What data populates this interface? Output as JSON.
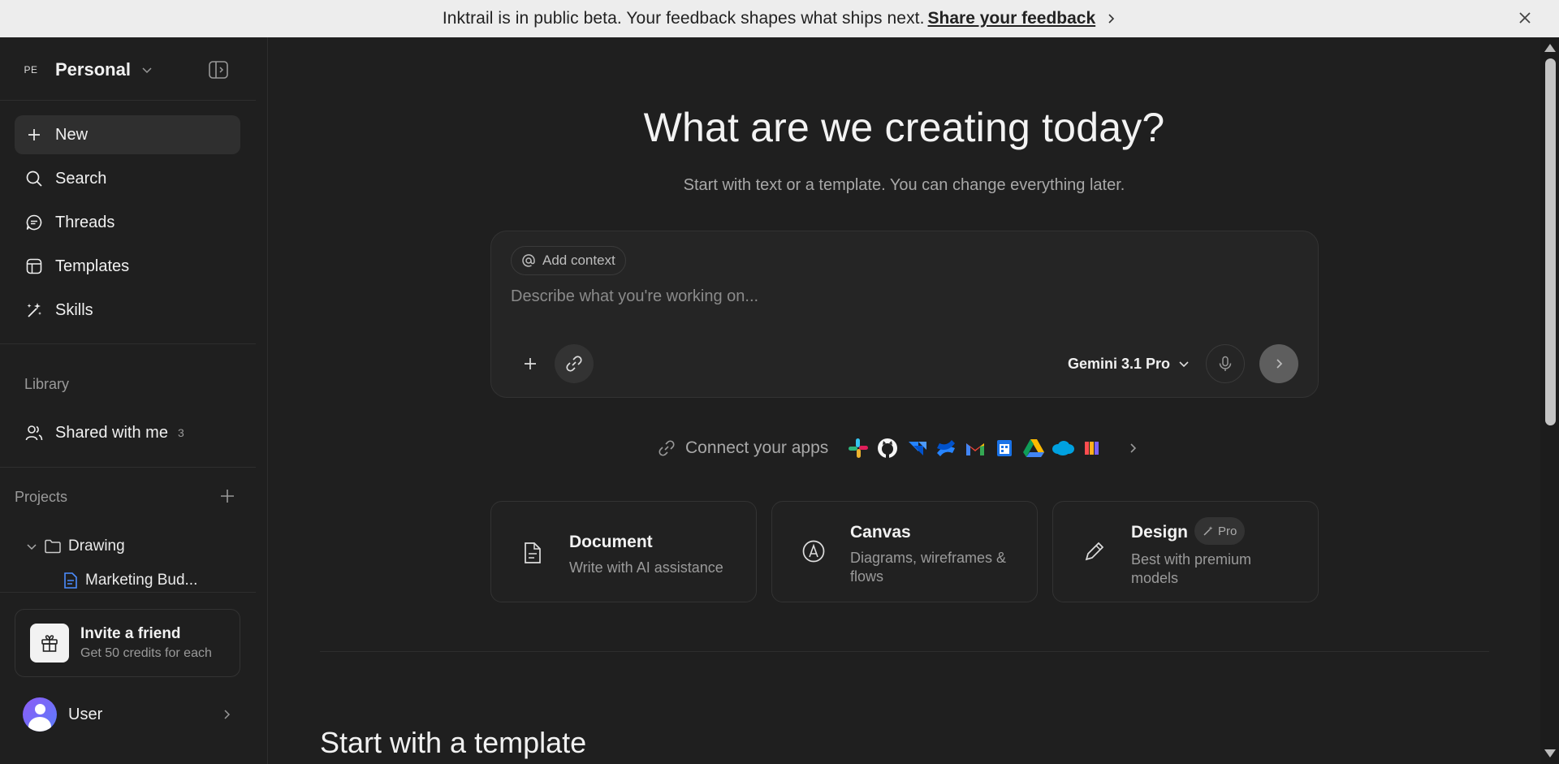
{
  "banner": {
    "message": "Inktrail is in public beta. Your feedback shapes what ships next.",
    "link_label": "Share your feedback"
  },
  "sidebar": {
    "workspace": {
      "badge": "PE",
      "name": "Personal"
    },
    "nav": [
      {
        "label": "New",
        "icon": "plus-icon"
      },
      {
        "label": "Search",
        "icon": "search-icon"
      },
      {
        "label": "Threads",
        "icon": "chat-bubble-icon"
      },
      {
        "label": "Templates",
        "icon": "template-icon"
      },
      {
        "label": "Skills",
        "icon": "sparkle-wand-icon"
      }
    ],
    "library_label": "Library",
    "shared": {
      "label": "Shared with me",
      "count": "3"
    },
    "projects_label": "Projects",
    "tree": {
      "folder": "Drawing",
      "file": "Marketing Bud..."
    },
    "invite": {
      "title": "Invite a friend",
      "subtitle": "Get 50 credits for each"
    },
    "user": {
      "name": "User"
    }
  },
  "main": {
    "title": "What are we creating today?",
    "subtitle": "Start with text or a template. You can change everything later.",
    "composer": {
      "context_chip": "Add context",
      "placeholder": "Describe what you're working on...",
      "model": "Gemini 3.1 Pro"
    },
    "connect_label": "Connect your apps",
    "apps": [
      "slack-icon",
      "github-icon",
      "jira-icon",
      "confluence-icon",
      "gmail-icon",
      "google-calendar-icon",
      "google-drive-icon",
      "salesforce-icon",
      "colorful-app-icon"
    ],
    "cards": [
      {
        "title": "Document",
        "subtitle": "Write with AI assistance"
      },
      {
        "title": "Canvas",
        "subtitle": "Diagrams, wireframes & flows"
      },
      {
        "title": "Design",
        "badge": "Pro",
        "subtitle": "Best with premium models"
      }
    ],
    "templates_heading": "Start with a template"
  },
  "colors": {
    "background": "#1f1f1f",
    "banner_bg": "#ededed",
    "accent_avatar": "#7a5cf6"
  }
}
